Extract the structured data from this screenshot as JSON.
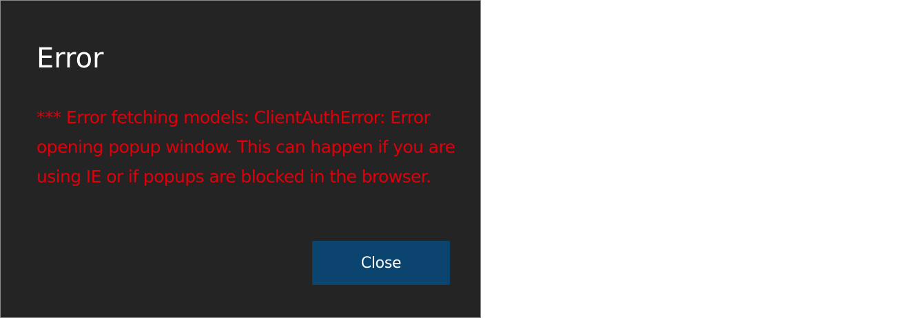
{
  "dialog": {
    "title": "Error",
    "message": "*** Error fetching models: ClientAuthError: Error opening popup window. This can happen if you are using IE or if popups are blocked in the browser.",
    "close_label": "Close"
  },
  "colors": {
    "dialog_background": "#242424",
    "message_text": "#e0000a",
    "button_background": "#0b456f",
    "title_text": "#ffffff"
  }
}
